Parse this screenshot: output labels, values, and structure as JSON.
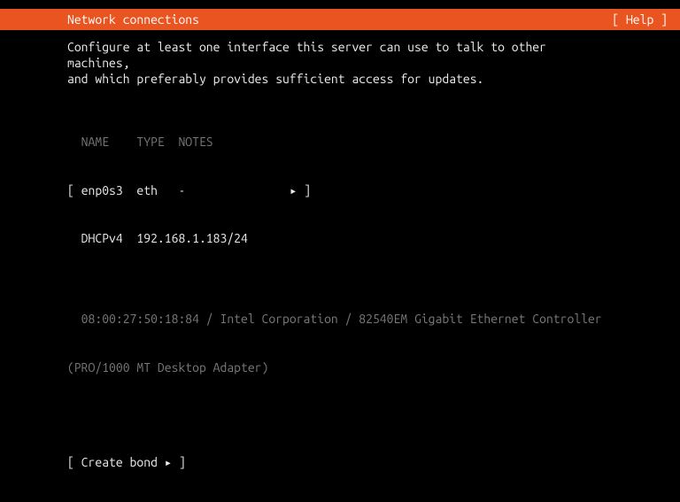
{
  "header": {
    "title": "Network connections",
    "help": "[ Help ]"
  },
  "description": {
    "line1": "Configure at least one interface this server can use to talk to other machines,",
    "line2": "and which preferably provides sufficient access for updates."
  },
  "table": {
    "header": "  NAME    TYPE  NOTES",
    "iface": {
      "open_bracket": "[",
      "name": "enp0s3",
      "type": "eth",
      "notes": "-",
      "arrow": "▸",
      "close_bracket": "]"
    },
    "dhcp_line": "  DHCPv4  192.168.1.183/24",
    "hw_line1": "  08:00:27:50:18:84 / Intel Corporation / 82540EM Gigabit Ethernet Controller",
    "hw_line2": "(PRO/1000 MT Desktop Adapter)"
  },
  "actions": {
    "create_bond": "[ Create bond ▸ ]"
  }
}
